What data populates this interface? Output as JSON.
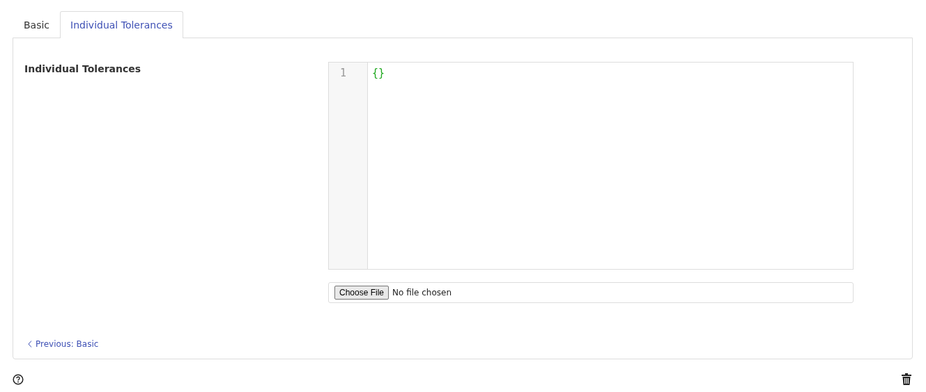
{
  "tabs": [
    {
      "label": "Basic",
      "selected": false
    },
    {
      "label": "Individual Tolerances",
      "selected": true
    }
  ],
  "field": {
    "label": "Individual Tolerances",
    "editor": {
      "line_numbers": [
        "1"
      ],
      "lines": [
        "{}"
      ]
    },
    "file_input": {
      "button": "Choose File",
      "status": "No file chosen"
    }
  },
  "previous_link": "Previous: Basic"
}
